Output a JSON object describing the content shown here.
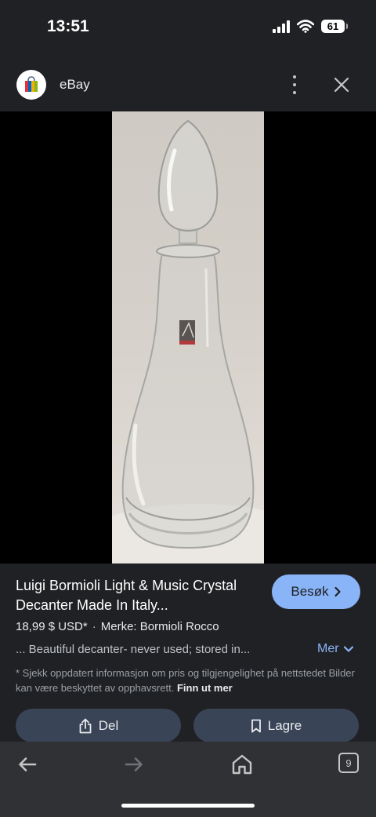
{
  "status_bar": {
    "time": "13:51",
    "battery": "61"
  },
  "header": {
    "site_name": "eBay"
  },
  "result": {
    "title": "Luigi Bormioli Light & Music Crystal Decanter Made In Italy...",
    "visit_label": "Besøk",
    "price": "18,99 $ USD*",
    "brand": "Merke: Bormioli Rocco",
    "snippet": "... Beautiful decanter- never used; stored in...",
    "more_label": "Mer",
    "disclaimer": "* Sjekk oppdatert informasjon om pris og tilgjengelighet på nettstedet Bilder kan være beskyttet av opphavsrett.",
    "disclaimer_link": "Finn ut mer",
    "share_label": "Del",
    "save_label": "Lagre"
  },
  "bottom_nav": {
    "tab_count": "9"
  },
  "icons": {
    "status": [
      "signal-icon",
      "wifi-icon",
      "battery-icon"
    ],
    "header": [
      "ebay-favicon-icon",
      "more-vert-icon",
      "close-icon"
    ],
    "actions": [
      "chevron-right-icon",
      "chevron-down-icon",
      "share-icon",
      "bookmark-icon"
    ],
    "nav": [
      "back-arrow-icon",
      "forward-arrow-icon",
      "home-icon",
      "tabs-icon"
    ]
  },
  "colors": {
    "accent": "#8ab4f8",
    "background": "#202124",
    "action_button": "#394457"
  }
}
